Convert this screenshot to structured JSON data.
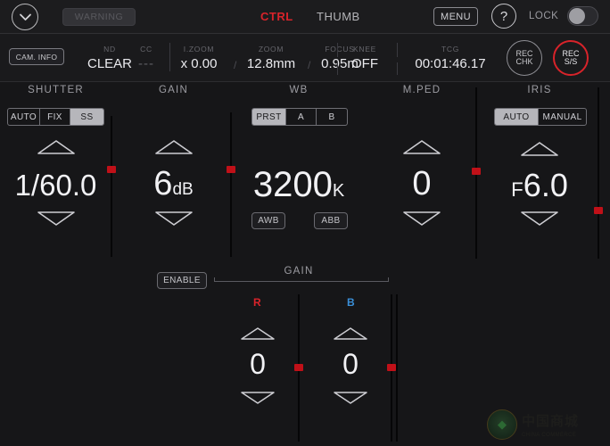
{
  "topbar": {
    "collapse_icon": "chevron-down-icon",
    "warning_label": "WARNING",
    "tab_ctrl": "CTRL",
    "tab_thumb": "THUMB",
    "menu_label": "MENU",
    "help_label": "?",
    "lock_label": "LOCK",
    "lock_state": "off",
    "accent_red": "#d8232a"
  },
  "infobar": {
    "cam_info_label": "CAM. INFO",
    "cells": [
      {
        "label": "ND",
        "value": "CLEAR"
      },
      {
        "label": "CC",
        "value": "---"
      },
      {
        "label": "I.ZOOM",
        "value": "x 0.00"
      },
      {
        "label": "ZOOM",
        "value": "12.8mm"
      },
      {
        "label": "FOCUS",
        "value": "0.95m"
      },
      {
        "label": "KNEE",
        "value": "OFF"
      },
      {
        "label": "TCG",
        "value": "00:01:46.17"
      }
    ],
    "rec_chk_line1": "REC",
    "rec_chk_line2": "CHK",
    "rec_ss_line1": "REC",
    "rec_ss_line2": "S/S"
  },
  "panels": {
    "shutter": {
      "title": "SHUTTER",
      "modes": [
        "AUTO",
        "FIX",
        "SS"
      ],
      "selected_mode": "SS",
      "value": "1/60.0",
      "slider_percent": 38
    },
    "gain": {
      "title": "GAIN",
      "value": "6",
      "unit": "dB",
      "slider_percent": 38
    },
    "wb": {
      "title": "WB",
      "modes": [
        "PRST",
        "A",
        "B"
      ],
      "selected_mode": "PRST",
      "value": "3200",
      "unit": "K",
      "awb_label": "AWB",
      "abb_label": "ABB"
    },
    "mped": {
      "title": "M.PED",
      "value": "0",
      "slider_percent": 48
    },
    "iris": {
      "title": "IRIS",
      "modes": [
        "AUTO",
        "MANUAL"
      ],
      "selected_mode": "AUTO",
      "prefix": "F",
      "value": "6.0",
      "slider_percent": 70
    }
  },
  "lower_gain": {
    "enable_label": "ENABLE",
    "title": "GAIN",
    "channels": [
      {
        "label": "R",
        "color": "#d8232a",
        "value": "0",
        "slider_percent": 50
      },
      {
        "label": "B",
        "color": "#3a8fd8",
        "value": "0",
        "slider_percent": 50
      }
    ]
  },
  "watermark": {
    "top": "中国商城",
    "bottom": "CHINA COMMERCE"
  }
}
